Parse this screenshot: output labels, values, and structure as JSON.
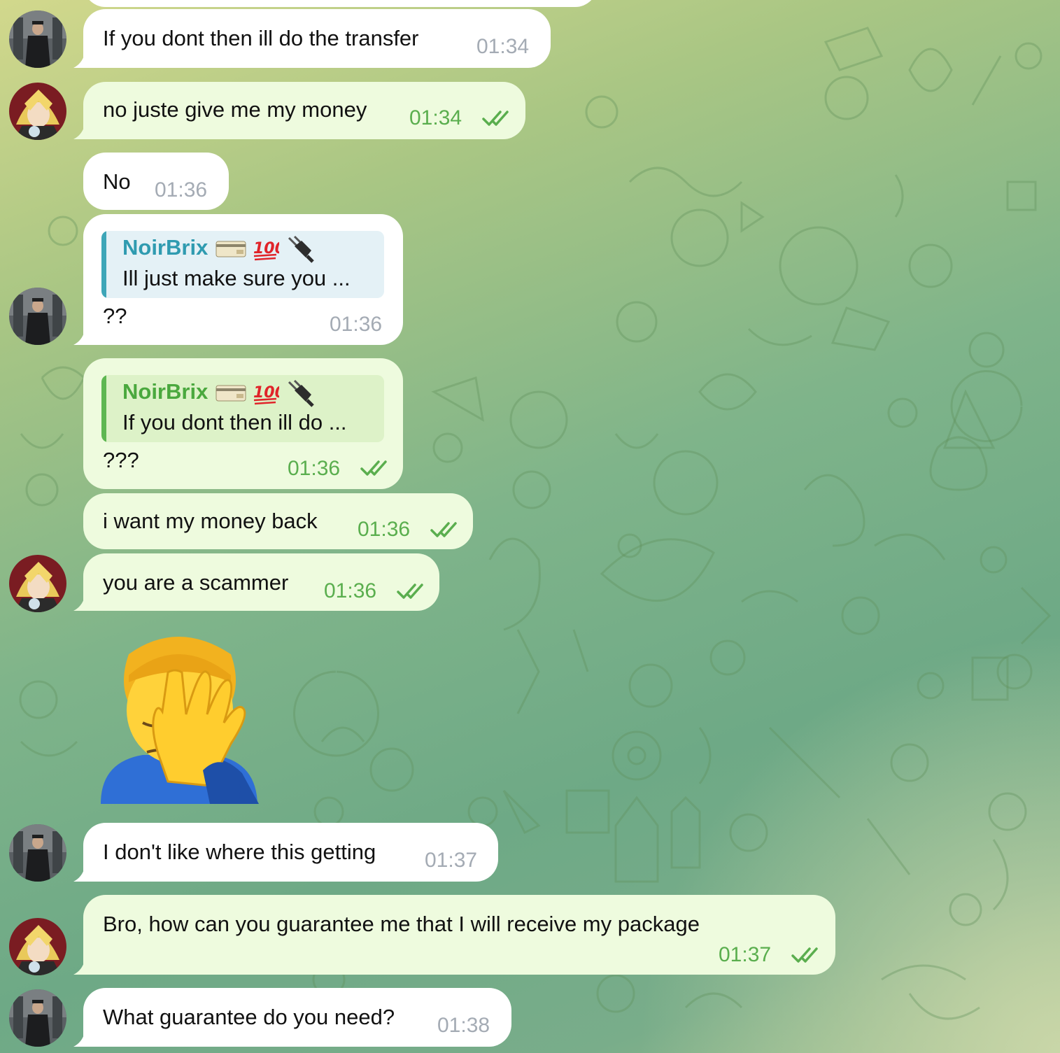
{
  "contacts": {
    "other": {
      "avatar_icon": "man-in-coat-avatar"
    },
    "me": {
      "avatar_icon": "blond-anime-avatar"
    }
  },
  "messages": [
    {
      "text": "If you dont then ill do the transfer",
      "time": "01:34",
      "direction": "in"
    },
    {
      "text": "no juste give me my money",
      "time": "01:34",
      "direction": "out",
      "status": "read"
    },
    {
      "text": "No",
      "time": "01:36",
      "direction": "in"
    },
    {
      "reply": {
        "name": "NoirBrix",
        "name_emojis": [
          "credit-card-icon",
          "hundred-points-icon",
          "electric-plug-icon"
        ],
        "text": "Ill just make sure you ..."
      },
      "text": "??",
      "time": "01:36",
      "direction": "in"
    },
    {
      "reply": {
        "name": "NoirBrix",
        "name_emojis": [
          "credit-card-icon",
          "hundred-points-icon",
          "electric-plug-icon"
        ],
        "text": "If you dont then ill do ..."
      },
      "text": "???",
      "time": "01:36",
      "direction": "out",
      "status": "read"
    },
    {
      "text": "i want my money back",
      "time": "01:36",
      "direction": "out",
      "status": "read"
    },
    {
      "text": "you are a scammer",
      "time": "01:36",
      "direction": "out",
      "status": "read"
    },
    {
      "sticker": "facepalm-emoji-sticker",
      "direction": "in"
    },
    {
      "text": "I don't like where this getting",
      "time": "01:37",
      "direction": "in"
    },
    {
      "text": "Bro, how can you guarantee me that I will receive my package",
      "time": "01:37",
      "direction": "out",
      "status": "read"
    },
    {
      "text": "What guarantee do you need?",
      "time": "01:38",
      "direction": "in"
    }
  ],
  "colors": {
    "incoming_bubble": "#ffffff",
    "outgoing_bubble": "#eefbde",
    "outgoing_time": "#5aae4e",
    "incoming_time": "#a4abb4",
    "reply_name_in": "#2f9bb0",
    "reply_name_out": "#4aa83e"
  }
}
